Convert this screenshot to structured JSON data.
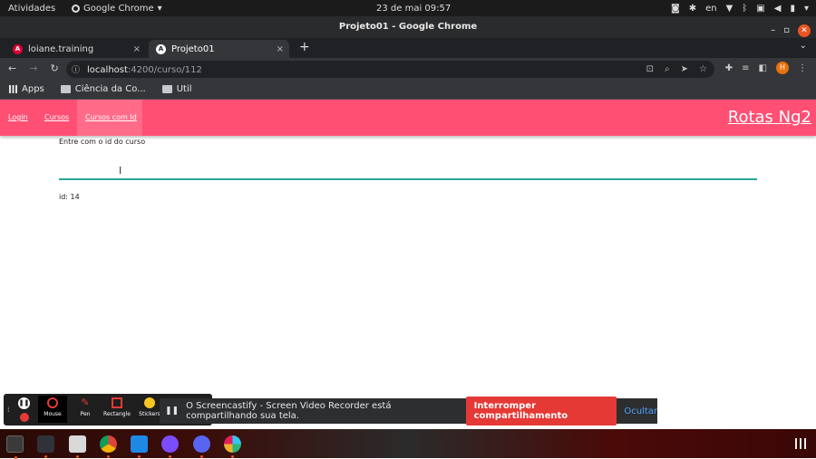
{
  "system": {
    "activities": "Atividades",
    "app_name": "Google Chrome",
    "clock": "23 de mai  09:57",
    "lang": "en"
  },
  "window": {
    "title": "Projeto01 - Google Chrome"
  },
  "tabs": [
    {
      "label": "loiane.training",
      "close": "×"
    },
    {
      "label": "Projeto01",
      "close": "×"
    }
  ],
  "new_tab": "+",
  "address": {
    "host": "localhost",
    "path": ":4200/curso/112"
  },
  "bookmarks": [
    {
      "label": "Apps"
    },
    {
      "label": "Ciência da Co..."
    },
    {
      "label": "Util"
    }
  ],
  "profile_initial": "H",
  "page": {
    "nav": [
      {
        "label": "Login"
      },
      {
        "label": "Cursos"
      },
      {
        "label": "Cursos com Id"
      }
    ],
    "brand": "Rotas Ng2",
    "input_label": "Entre com o id do curso",
    "input_value": "",
    "id_text": "id: 14"
  },
  "screencastify": {
    "tools": [
      {
        "label": "Mouse"
      },
      {
        "label": "Pen"
      },
      {
        "label": "Rectangle"
      },
      {
        "label": "Stickers"
      }
    ],
    "share_text": "O Screencastify - Screen Video Recorder está compartilhando sua tela.",
    "stop_button": "Interromper compartilhamento",
    "hide_button": "Ocultar"
  },
  "colors": {
    "brand_bar": "#ff4f73",
    "input_underline": "#26a69a",
    "stop_button": "#e53935"
  }
}
